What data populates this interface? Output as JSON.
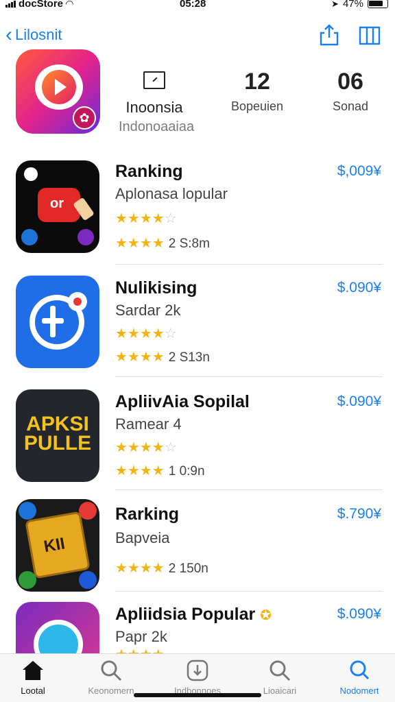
{
  "status_bar": {
    "carrier": "docStore",
    "time": "05:28",
    "battery": "47%"
  },
  "nav": {
    "back_label": "Lilosnit",
    "share_icon": "share-icon",
    "columns_icon": "columns-icon"
  },
  "header": {
    "name": "Inoonsia",
    "subtitle": "Indonoaaiaa",
    "stats": [
      {
        "value": "",
        "label": "Inoonsia",
        "icon": "tablet-icon"
      },
      {
        "value": "12",
        "label": "Bopeuien"
      },
      {
        "value": "06",
        "label": "Sonad"
      }
    ]
  },
  "apps": [
    {
      "title": "Ranking",
      "subtitle": "Aplonasa lopular",
      "rating_stars": "★★★★",
      "rating_empty": "☆",
      "meta": "",
      "stars2": "★★★★",
      "stars2_empty": "",
      "meta2": "2  S:8m",
      "price": "$,009¥"
    },
    {
      "title": "Nulikising",
      "subtitle": "Sardar 2k",
      "rating_stars": "★★★★",
      "rating_empty": "☆",
      "meta": "",
      "stars2": "★★★★",
      "stars2_empty": "",
      "meta2": "2  S13n",
      "price": "$.090¥"
    },
    {
      "title": "ApliivAia Sopilal",
      "subtitle": "Ramear 4",
      "rating_stars": "★★★★",
      "rating_empty": "☆",
      "meta": "",
      "stars2": "★★★★",
      "stars2_empty": "",
      "meta2": "1  0:9n",
      "price": "$.090¥",
      "icon_text": [
        "APKSI",
        "PULLE"
      ]
    },
    {
      "title": "Rarking",
      "subtitle": "Bapveia",
      "rating_stars": "",
      "rating_empty": "",
      "meta": "",
      "stars2": "★★★★",
      "stars2_empty": "",
      "meta2": "2  150n",
      "price": "$.790¥"
    },
    {
      "title": "Apliidsia Popular",
      "subtitle": "Papr 2k",
      "rating_stars": "★★★★",
      "rating_empty": "",
      "meta": "",
      "stars2": "",
      "stars2_empty": "",
      "meta2": "",
      "price": "$.090¥"
    }
  ],
  "tabs": [
    {
      "label": "Lootal",
      "icon": "home-icon",
      "active": false
    },
    {
      "label": "Keonomern",
      "icon": "search-icon",
      "active": false
    },
    {
      "label": "Indbonnoes",
      "icon": "download-icon",
      "active": false
    },
    {
      "label": "Lioaicari",
      "icon": "search-icon",
      "active": false
    },
    {
      "label": "Nodomert",
      "icon": "search-icon",
      "active": true
    }
  ],
  "colors": {
    "accent": "#1a7ff0",
    "star": "#f3b312"
  }
}
